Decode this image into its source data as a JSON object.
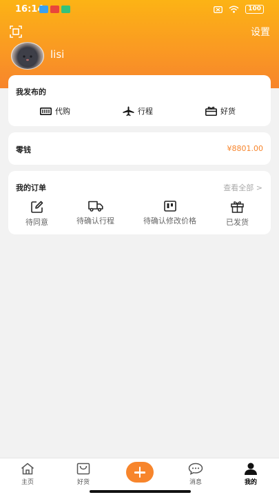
{
  "status_bar": {
    "time": "16:14",
    "battery": "100"
  },
  "header": {
    "settings_label": "设置",
    "username": "lisi"
  },
  "publish_card": {
    "title": "我发布的",
    "items": [
      {
        "label": "代购",
        "icon": "barcode-icon"
      },
      {
        "label": "行程",
        "icon": "airplane-icon"
      },
      {
        "label": "好货",
        "icon": "gift-box-icon"
      }
    ]
  },
  "wallet": {
    "label": "零钱",
    "amount": "¥8801.00"
  },
  "orders": {
    "title": "我的订单",
    "view_all": "查看全部 >",
    "items": [
      {
        "label": "待同意",
        "icon": "edit-icon"
      },
      {
        "label": "待确认行程",
        "icon": "truck-icon"
      },
      {
        "label": "待确认修改价格",
        "icon": "board-icon"
      },
      {
        "label": "已发货",
        "icon": "gift-icon"
      }
    ]
  },
  "tabbar": {
    "tabs": [
      {
        "label": "主页",
        "icon": "home-icon"
      },
      {
        "label": "好货",
        "icon": "bag-icon"
      },
      {
        "label": "消息",
        "icon": "chat-icon"
      },
      {
        "label": "我的",
        "icon": "user-icon"
      }
    ],
    "active": "我的"
  },
  "colors": {
    "accent": "#f7852c",
    "header_top": "#fcb315"
  }
}
